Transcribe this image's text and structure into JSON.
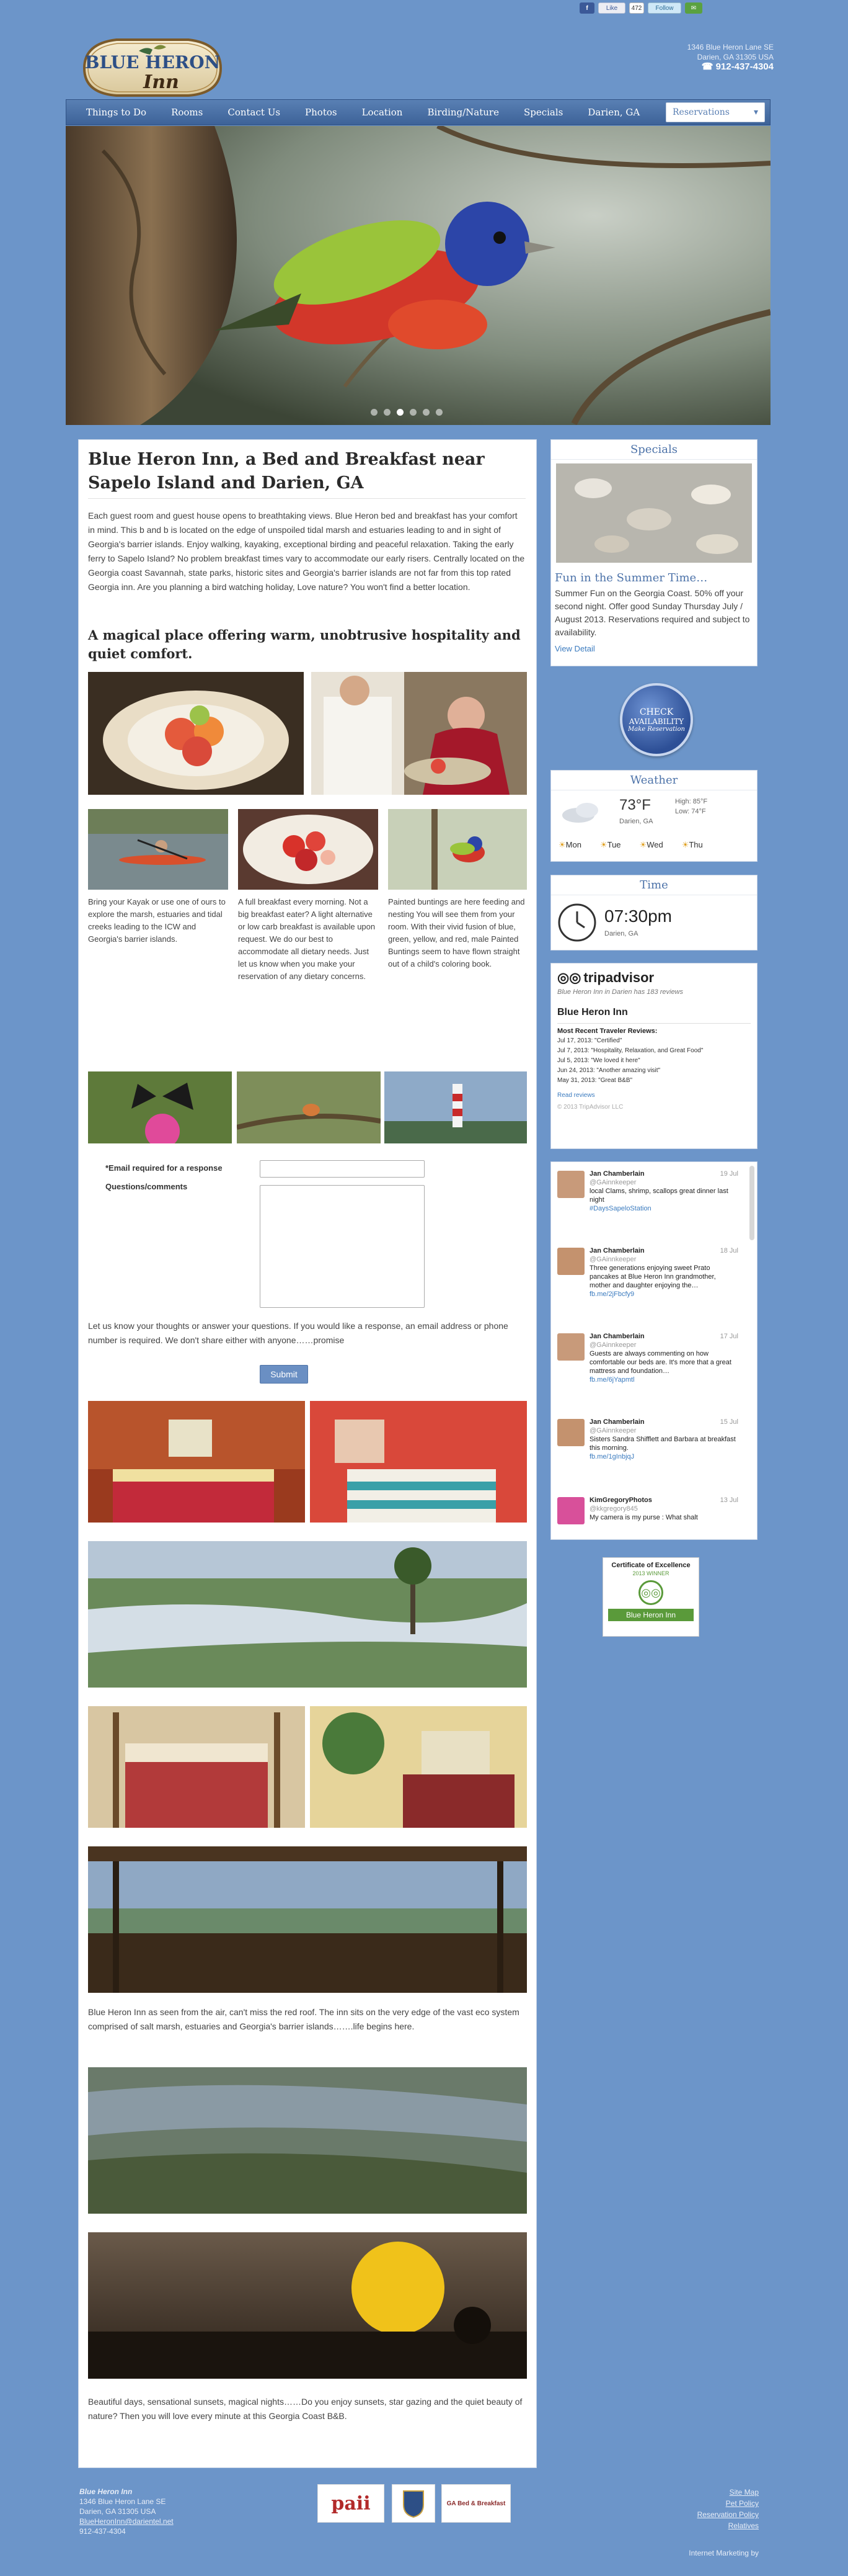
{
  "social": {
    "fb": "f",
    "like": "Like",
    "count": "472",
    "follow": "Follow"
  },
  "header": {
    "logo_top": "BLUE HERON",
    "logo_bottom": "Inn",
    "address1": "1346 Blue Heron Lane SE",
    "address2": "Darien, GA 31305 USA",
    "phone": "912-437-4304"
  },
  "nav": {
    "items": [
      "Things to Do",
      "Rooms",
      "Contact Us",
      "Photos",
      "Location",
      "Birding/Nature",
      "Specials",
      "Darien, GA"
    ],
    "reservations": "Reservations"
  },
  "main": {
    "title": "Blue Heron Inn, a Bed and Breakfast near Sapelo Island and Darien, GA",
    "intro": "Each guest room and guest house opens to breathtaking views. Blue Heron bed and breakfast has your comfort in mind. This b and b is located on the edge of unspoiled tidal marsh and estuaries leading to and in sight of Georgia's barrier islands. Enjoy walking, kayaking, exceptional birding and peaceful relaxation. Taking the early ferry to Sapelo Island? No problem breakfast times vary to accommodate our early risers. Centrally located on the Georgia coast Savannah, state parks, historic sites and Georgia's barrier islands are not far from this top rated Georgia inn. Are you planning a bird watching holiday, Love nature? You won't find a better location.",
    "subheading": "A magical place offering warm, unobtrusive hospitality and quiet comfort.",
    "captions": [
      "Bring your Kayak or use one of ours to explore the marsh, estuaries and tidal creeks leading to the ICW and Georgia's barrier islands.",
      "A full breakfast every morning. Not a big breakfast eater? A light alternative or low carb breakfast is available upon request. We do our best to accommodate all dietary needs. Just let us know when you make your reservation of any dietary concerns.",
      "Painted buntings are here feeding and nesting You will see them from your room. With their vivid fusion of blue, green, yellow, and red, male Painted Buntings seem to have flown straight out of a child's coloring book."
    ],
    "form": {
      "email_label": "*Email required for a response",
      "questions_label": "Questions/comments",
      "note": "Let us know your thoughts or answer your questions. If you would like a response, an email address or phone number is required. We don't share either with anyone……promise",
      "submit": "Submit"
    },
    "roof_text": "Blue Heron Inn as seen from the air, can't miss the red roof. The inn sits on the very edge of the vast eco system comprised of salt marsh, estuaries and Georgia's barrier islands…….life begins here.",
    "sunset_text": "Beautiful days, sensational sunsets, magical nights……Do you enjoy sunsets, star gazing and the quiet beauty of nature? Then you will love every minute at this Georgia Coast B&B."
  },
  "sidebar": {
    "specials": {
      "head": "Specials",
      "title": "Fun in the Summer Time…",
      "body": "Summer Fun on the Georgia Coast. 50% off your second night. Offer good Sunday Thursday July / August 2013. Reservations required and subject to availability.",
      "link": "View Detail"
    },
    "check": {
      "line1": "CHECK",
      "line2": "AVAILABILITY",
      "line3": "Make Reservation"
    },
    "weather": {
      "head": "Weather",
      "temp": "73°F",
      "high": "High: 85°F",
      "low": "Low: 74°F",
      "location": "Darien, GA",
      "days": [
        "Mon",
        "Tue",
        "Wed",
        "Thu"
      ]
    },
    "time": {
      "head": "Time",
      "clock": "07:30pm",
      "location": "Darien, GA"
    },
    "tripadvisor": {
      "logo": "tripadvisor",
      "subtitle": "Blue Heron Inn in Darien has 183 reviews",
      "name": "Blue Heron Inn",
      "reviews_head": "Most Recent Traveler Reviews:",
      "reviews": [
        "Jul 17, 2013: \"Certified\"",
        "Jul 7, 2013: \"Hospitality, Relaxation, and Great Food\"",
        "Jul 5, 2013: \"We loved it here\"",
        "Jun 24, 2013: \"Another amazing visit\"",
        "May 31, 2013: \"Great B&B\""
      ],
      "read": "Read reviews",
      "copyright": "© 2013 TripAdvisor LLC"
    },
    "tweets": [
      {
        "name": "Jan Chamberlain",
        "handle": "@GAinnkeeper",
        "date": "19 Jul",
        "text": "local Clams, shrimp, scallops great dinner last night",
        "tag": "#DaysSapeloStation"
      },
      {
        "name": "Jan Chamberlain",
        "handle": "@GAinnkeeper",
        "date": "18 Jul",
        "text": "Three generations enjoying sweet Prato pancakes at Blue Heron Inn grandmother, mother and daughter enjoying the…",
        "tag": "fb.me/2jFbcfy9"
      },
      {
        "name": "Jan Chamberlain",
        "handle": "@GAinnkeeper",
        "date": "17 Jul",
        "text": "Guests are always commenting on how comfortable our beds are. It's more that a great mattress and foundation…",
        "tag": "fb.me/6jYapmtl"
      },
      {
        "name": "Jan Chamberlain",
        "handle": "@GAinnkeeper",
        "date": "15 Jul",
        "text": "Sisters Sandra Shifflett and Barbara at breakfast this morning.",
        "tag": "fb.me/1gInbjqJ"
      },
      {
        "name": "KimGregoryPhotos",
        "handle": "@kkgregory845",
        "date": "13 Jul",
        "text": "My camera is my purse : What shalt",
        "tag": ""
      }
    ],
    "certificate": {
      "line1": "Certificate of Excellence",
      "line2": "2013 WINNER",
      "name": "Blue Heron Inn"
    }
  },
  "footer": {
    "left": [
      "Blue Heron Inn",
      "1346 Blue Heron Lane SE",
      "Darien, GA 31305 USA",
      "BlueHeronInn@darientel.net",
      "912-437-4304"
    ],
    "right": [
      "Site Map",
      "Pet Policy",
      "Reservation Policy",
      "Relatives"
    ],
    "marketing": "Internet Marketing by",
    "badges": [
      "paii",
      "",
      "GA Bed & Breakfast"
    ]
  },
  "colors": {
    "page_bg": "#6c95c9",
    "nav": "#4a70a6",
    "accent": "#5a7fb3",
    "link": "#3b7bbf"
  }
}
